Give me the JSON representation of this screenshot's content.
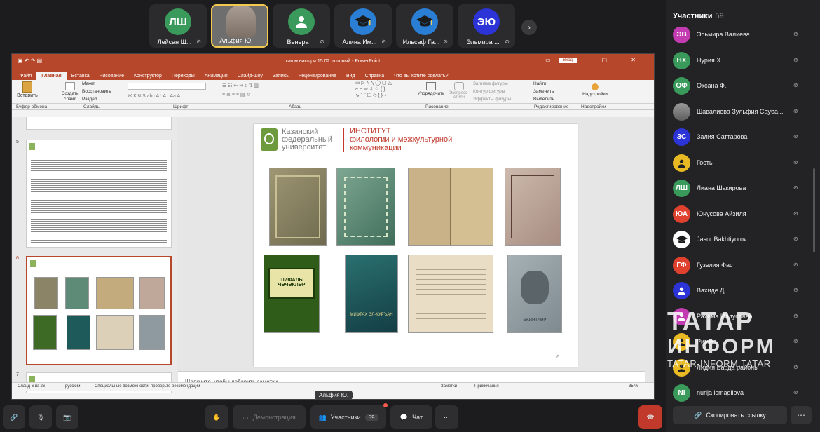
{
  "participants_strip": [
    {
      "initials": "ЛШ",
      "name": "Лейсан Ш...",
      "color": "#3a9a5b"
    },
    {
      "initials": "",
      "name": "Альфия Ю.",
      "color": "#777777",
      "active": true
    },
    {
      "initials": "",
      "name": "Венера",
      "color": "#3a9a5b",
      "icon": "person-icon"
    },
    {
      "initials": "",
      "name": "Алина Им...",
      "color": "#2a7fd4",
      "icon": "graduation-cap-icon"
    },
    {
      "initials": "",
      "name": "Ильсаф Га...",
      "color": "#2a7fd4",
      "icon": "graduation-cap-icon"
    },
    {
      "initials": "ЭЮ",
      "name": "Эльмира ...",
      "color": "#2c34d8"
    }
  ],
  "ppt": {
    "title": "каюм насыри 15.02. готовый - PowerPoint",
    "login": "Вход",
    "window_controls": "▭ – ▢ ✕",
    "tabs": [
      "Файл",
      "Главная",
      "Вставка",
      "Рисование",
      "Конструктор",
      "Переходы",
      "Анимация",
      "Слайд-шоу",
      "Запись",
      "Рецензирование",
      "Вид",
      "Справка",
      "Что вы хотите сделать?"
    ],
    "ribbon": {
      "paste": "Вставить",
      "create_slide": "Создать слайд",
      "layout": "Макет",
      "restore": "Восстановить",
      "section": "Раздел",
      "shape_fill": "Заливка фигуры",
      "shape_outline": "Контур фигуры",
      "shape_effects": "Эффекты фигуры",
      "arrange": "Упорядочить",
      "styles": "Экспресс-стили",
      "find": "Найти",
      "replace": "Заменить",
      "select": "Выделить",
      "addins": "Надстройки"
    },
    "group_labels": [
      "Буфер обмена",
      "Слайды",
      "Шрифт",
      "Абзац",
      "Рисование",
      "Редактирование",
      "Надстройки"
    ],
    "slide_numbers": [
      "5",
      "6",
      "7"
    ],
    "university": [
      "Казанский",
      "федеральный",
      "университет"
    ],
    "institute": [
      "ИНСТИТУТ",
      "филологии и межкультурной",
      "коммуникации"
    ],
    "slide_page": "6",
    "notes_placeholder": "Щелкните, чтобы добавить заметки",
    "status": {
      "slide": "Слайд 6 из 26",
      "lang": "русский",
      "accessibility": "Специальные возможности: проверьте рекомендации",
      "notes": "Заметки",
      "comments": "Примечания",
      "zoom": "85 %"
    },
    "book_titles": [
      "ШИФАЛЫ ЧӘЧӘКЛӘР",
      "МИФТАХ ЭЛ-КУРЪАН",
      "ӘКИЯТЛӘР"
    ]
  },
  "panel": {
    "header": "Участники",
    "count": "59",
    "participants": [
      {
        "initials": "ЭВ",
        "name": "Эльмира Валиева",
        "color": "#c23bb0"
      },
      {
        "initials": "НХ",
        "name": "Нурия Х.",
        "color": "#3a9a5b"
      },
      {
        "initials": "ОФ",
        "name": "Оксана Ф.",
        "color": "#3a9a5b"
      },
      {
        "initials": "",
        "name": "Шавалиева Зульфия Сауба...",
        "color": "#8a8a8a",
        "photo": true
      },
      {
        "initials": "ЗС",
        "name": "Залия Саттарова",
        "color": "#2c34d8"
      },
      {
        "initials": "",
        "name": "Гость",
        "color": "#e8b923",
        "icon": "person-icon"
      },
      {
        "initials": "ЛШ",
        "name": "Лиана Шакирова",
        "color": "#3a9a5b"
      },
      {
        "initials": "ЮА",
        "name": "Юнусова Айзиля",
        "color": "#e0412f"
      },
      {
        "initials": "",
        "name": "Jasur Bakhtiyorov",
        "color": "#2a7fd4",
        "icon": "graduation-cap-icon"
      },
      {
        "initials": "ГФ",
        "name": "Гузелия Фас",
        "color": "#e0412f"
      },
      {
        "initials": "",
        "name": "Вахиде Д.",
        "color": "#2c34d8",
        "icon": "person-icon"
      },
      {
        "initials": "",
        "name": "Рахима Илдусовна",
        "color": "#c23bb0",
        "icon": "person-icon"
      },
      {
        "initials": "",
        "name": "Римма",
        "color": "#e8b923",
        "icon": "person-icon"
      },
      {
        "initials": "",
        "name": "Лидия Барда районы",
        "color": "#e8b923",
        "icon": "person-icon"
      },
      {
        "initials": "NI",
        "name": "nurija ismagilova",
        "color": "#3a9a5b"
      }
    ],
    "copy_link": "Скопировать ссылку"
  },
  "watermark": [
    "ТАТАР",
    "ИНФОРМ",
    "TATAR-INFORM.TATAR"
  ],
  "toolbar": {
    "demo": "Демонстрация",
    "participants": "Участники",
    "participants_count": "59",
    "chat": "Чат",
    "presenter_tag": "Альфия Ю."
  },
  "colors": {
    "accent": "#b7472a",
    "end_call": "#c0392b",
    "institute": "#c0392b"
  }
}
